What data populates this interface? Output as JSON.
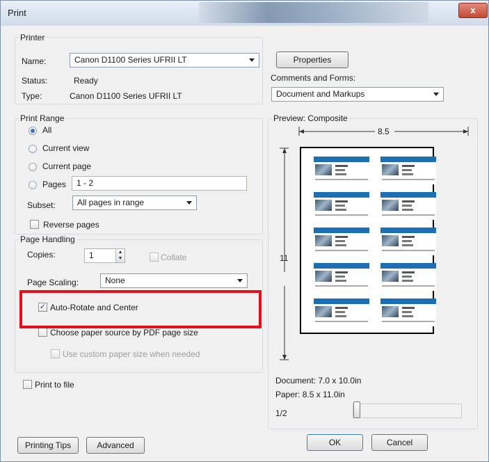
{
  "window": {
    "title": "Print",
    "close_glyph": "x"
  },
  "printer": {
    "group_label": "Printer",
    "name_label": "Name:",
    "name_value": "Canon D1100 Series UFRII LT",
    "status_label": "Status:",
    "status_value": "Ready",
    "type_label": "Type:",
    "type_value": "Canon D1100 Series UFRII LT",
    "properties_button": "Properties"
  },
  "comments": {
    "label": "Comments and Forms:",
    "value": "Document and Markups"
  },
  "print_range": {
    "group_label": "Print Range",
    "all": "All",
    "current_view": "Current view",
    "current_page": "Current page",
    "pages": "Pages",
    "pages_value": "1 - 2",
    "subset_label": "Subset:",
    "subset_value": "All pages in range",
    "reverse_pages": "Reverse pages"
  },
  "page_handling": {
    "group_label": "Page Handling",
    "copies_label": "Copies:",
    "copies_value": "1",
    "collate": "Collate",
    "scaling_label": "Page Scaling:",
    "scaling_value": "None",
    "auto_rotate": "Auto-Rotate and Center",
    "choose_paper": "Choose paper source by PDF page size",
    "custom_paper": "Use custom paper size when needed"
  },
  "print_to_file": "Print to file",
  "preview": {
    "label": "Preview: Composite",
    "width_label": "8.5",
    "height_label": "11",
    "document_size": "Document: 7.0 x 10.0in",
    "paper_size": "Paper: 8.5 x 11.0in",
    "page_indicator": "1/2",
    "card_header_color": "#1c6fb5"
  },
  "buttons": {
    "printing_tips": "Printing Tips",
    "advanced": "Advanced",
    "ok": "OK",
    "cancel": "Cancel"
  }
}
